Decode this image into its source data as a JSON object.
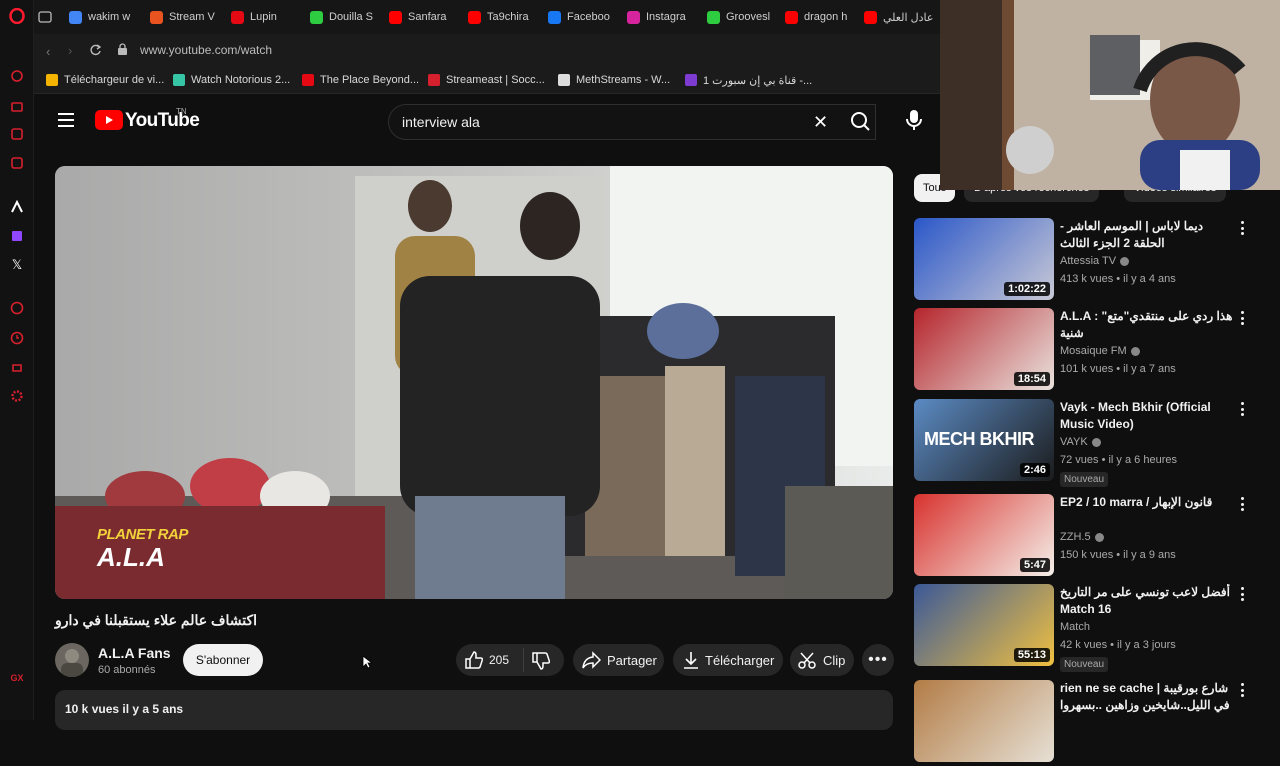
{
  "browser": {
    "tabs": [
      {
        "label": "wakim w",
        "icon": "google-icon",
        "color": "#4285f4"
      },
      {
        "label": "Stream V",
        "icon": "stream-icon",
        "color": "#e8531f"
      },
      {
        "label": "Lupin",
        "icon": "netflix-icon",
        "color": "#e50914"
      },
      {
        "label": "Douilla S",
        "icon": "groovesharks-icon",
        "color": "#2ecc40"
      },
      {
        "label": "Sanfara",
        "icon": "youtube-icon",
        "color": "#ff0000"
      },
      {
        "label": "Ta9chira",
        "icon": "youtube-icon",
        "color": "#ff0000"
      },
      {
        "label": "Faceboo",
        "icon": "facebook-icon",
        "color": "#1877f2"
      },
      {
        "label": "Instagra",
        "icon": "instagram-icon",
        "color": "#d6249f"
      },
      {
        "label": "Groovesl",
        "icon": "groovesharks-icon",
        "color": "#2ecc40"
      },
      {
        "label": "dragon h",
        "icon": "youtube-icon",
        "color": "#ff0000"
      },
      {
        "label": "عادل العلي",
        "icon": "youtube-icon",
        "color": "#ff0000"
      }
    ],
    "url": "www.youtube.com/watch",
    "bookmarks": [
      {
        "label": "Téléchargeur de vi...",
        "icon": "bookmark-icon",
        "color": "#f5b400"
      },
      {
        "label": "Watch Notorious 2...",
        "icon": "s-icon",
        "color": "#36c6a6"
      },
      {
        "label": "The Place Beyond...",
        "icon": "film-icon",
        "color": "#e50914"
      },
      {
        "label": "Streameast | Socc...",
        "icon": "streameast-icon",
        "color": "#d6202d"
      },
      {
        "label": "MethStreams - W...",
        "icon": "m-icon",
        "color": "#dddddd"
      },
      {
        "label": "قناة بي إن سبورت 1 -... ",
        "icon": "tv-icon",
        "color": "#7e3bd1"
      }
    ]
  },
  "youtube": {
    "logo_text": "YouTube",
    "logo_region": "TN",
    "search_query": "interview ala"
  },
  "video": {
    "overlay_top": "PLANET RAP",
    "overlay_bottom": "A.L.A",
    "title": "اكتشاف عالم علاء يستقبلنا في دارو",
    "channel_name": "A.L.A Fans",
    "subscribers": "60 abonnés",
    "subscribe_label": "S'abonner",
    "likes": "205",
    "share_label": "Partager",
    "download_label": "Télécharger",
    "clip_label": "Clip",
    "views_date": "10 k vues  il y a 5 ans"
  },
  "recommendations": {
    "chips": [
      "Tous",
      "D'après vos recherches",
      "Vidéos similaires"
    ],
    "items": [
      {
        "title": "ديما لاباس | الموسم العاشر - الحلقة 2 الجزء الثالث",
        "channel": "Attessia TV",
        "verified": true,
        "meta": "413 k vues • il y a 4 ans",
        "duration": "1:02:22",
        "badge": ""
      },
      {
        "title": "A.L.A : \"هذا ردي على منتقدي\"متع شنية",
        "channel": "Mosaique FM",
        "verified": true,
        "meta": "101 k vues • il y a 7 ans",
        "duration": "18:54",
        "badge": ""
      },
      {
        "title": "Vayk - Mech Bkhir (Official Music Video)",
        "channel": "VAYK",
        "verified": true,
        "meta": "72 vues • il y a 6 heures",
        "duration": "2:46",
        "badge": "Nouveau",
        "thumb_text": "MECH BKHIR"
      },
      {
        "title": "EP2 / 10 marra / قانون الإبهار",
        "channel": "ZZH.5",
        "verified": true,
        "meta": "150 k vues • il y a 9 ans",
        "duration": "5:47",
        "badge": ""
      },
      {
        "title": "أفضل لاعب تونسي على مر التاريخ Match 16",
        "channel": "Match",
        "verified": false,
        "meta": "42 k vues • il y a 3 jours",
        "duration": "55:13",
        "badge": "Nouveau"
      },
      {
        "title": "rien ne se cache | شارع بورقيبة في الليل..شايخين وزاهين ..بسهروا والمخ مرتاح",
        "channel": "",
        "verified": false,
        "meta": "",
        "duration": "",
        "badge": ""
      }
    ]
  },
  "colors": {
    "youtube_red": "#ff0000",
    "bg": "#0f0f0f",
    "pill": "#272727"
  }
}
